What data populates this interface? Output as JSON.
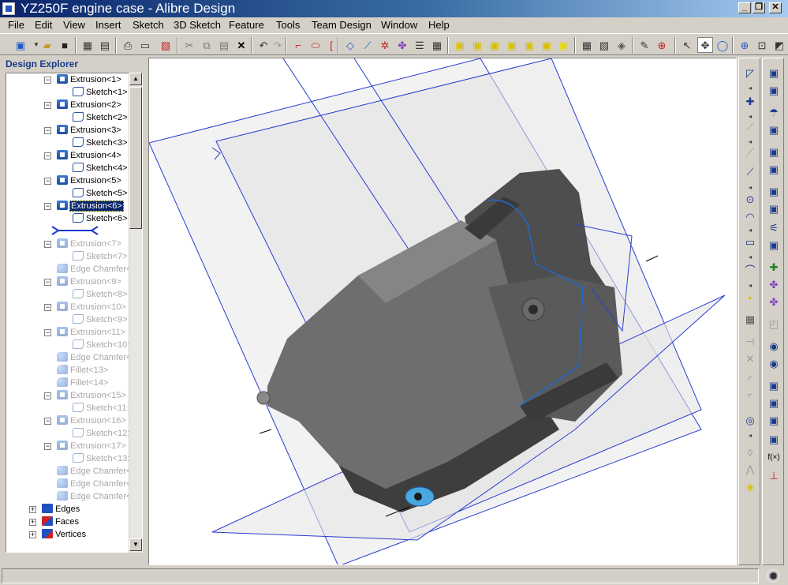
{
  "window": {
    "title": "YZ250F engine case - Alibre Design"
  },
  "menu": [
    "File",
    "Edit",
    "View",
    "Insert",
    "Sketch",
    "3D Sketch",
    "Feature",
    "Tools",
    "Team Design",
    "Window",
    "Help"
  ],
  "explorer": {
    "title": "Design Explorer",
    "nodes": [
      {
        "label": "Extrusion<1>",
        "icon": "extrusion-icon",
        "state": "active"
      },
      {
        "label": "Sketch<1>",
        "icon": "sketch-icon",
        "state": "active"
      },
      {
        "label": "Extrusion<2>",
        "icon": "extrusion-icon",
        "state": "active"
      },
      {
        "label": "Sketch<2>",
        "icon": "sketch-icon",
        "state": "active"
      },
      {
        "label": "Extrusion<3>",
        "icon": "extrusion-icon",
        "state": "active"
      },
      {
        "label": "Sketch<3>",
        "icon": "sketch-icon",
        "state": "active"
      },
      {
        "label": "Extrusion<4>",
        "icon": "extrusion-icon",
        "state": "active"
      },
      {
        "label": "Sketch<4>",
        "icon": "sketch-icon",
        "state": "active"
      },
      {
        "label": "Extrusion<5>",
        "icon": "extrusion-icon",
        "state": "active"
      },
      {
        "label": "Sketch<5>",
        "icon": "sketch-icon",
        "state": "active"
      },
      {
        "label": "Extrusion<6>",
        "icon": "extrusion-icon",
        "state": "selected"
      },
      {
        "label": "Sketch<6>",
        "icon": "sketch-icon",
        "state": "active"
      },
      {
        "label": "",
        "icon": "rollback-marker-icon",
        "state": "marker"
      },
      {
        "label": "Extrusion<7>",
        "icon": "extrusion-icon",
        "state": "suppressed"
      },
      {
        "label": "Sketch<7>",
        "icon": "sketch-icon",
        "state": "suppressed"
      },
      {
        "label": "Edge Chamfer<",
        "icon": "chamfer-icon",
        "state": "suppressed"
      },
      {
        "label": "Extrusion<9>",
        "icon": "extrusion-icon",
        "state": "suppressed"
      },
      {
        "label": "Sketch<8>",
        "icon": "sketch-icon",
        "state": "suppressed"
      },
      {
        "label": "Extrusion<10>",
        "icon": "extrusion-icon",
        "state": "suppressed"
      },
      {
        "label": "Sketch<9>",
        "icon": "sketch-icon",
        "state": "suppressed"
      },
      {
        "label": "Extrusion<11>",
        "icon": "extrusion-icon",
        "state": "suppressed"
      },
      {
        "label": "Sketch<10:",
        "icon": "sketch-icon",
        "state": "suppressed"
      },
      {
        "label": "Edge Chamfer<",
        "icon": "chamfer-icon",
        "state": "suppressed"
      },
      {
        "label": "Fillet<13>",
        "icon": "fillet-icon",
        "state": "suppressed"
      },
      {
        "label": "Fillet<14>",
        "icon": "fillet-icon",
        "state": "suppressed"
      },
      {
        "label": "Extrusion<15>",
        "icon": "extrusion-icon",
        "state": "suppressed"
      },
      {
        "label": "Sketch<11:",
        "icon": "sketch-icon",
        "state": "suppressed"
      },
      {
        "label": "Extrusion<16>",
        "icon": "extrusion-icon",
        "state": "suppressed"
      },
      {
        "label": "Sketch<12:",
        "icon": "sketch-icon",
        "state": "suppressed"
      },
      {
        "label": "Extrusion<17>",
        "icon": "extrusion-icon",
        "state": "suppressed"
      },
      {
        "label": "Sketch<13:",
        "icon": "sketch-icon",
        "state": "suppressed"
      },
      {
        "label": "Edge Chamfer<",
        "icon": "chamfer-icon",
        "state": "suppressed"
      },
      {
        "label": "Edge Chamfer<",
        "icon": "chamfer-icon",
        "state": "suppressed"
      },
      {
        "label": "Edge Chamfer<",
        "icon": "chamfer-icon",
        "state": "suppressed"
      }
    ],
    "groups": [
      {
        "label": "Edges",
        "icon": "edges-icon"
      },
      {
        "label": "Faces",
        "icon": "faces-icon"
      },
      {
        "label": "Vertices",
        "icon": "vertices-icon"
      }
    ]
  },
  "toolbar_icons": [
    "new-part-icon",
    "open-icon",
    "save-icon",
    "save-all-icon",
    "print-icon",
    "print-preview-icon",
    "pdf-icon",
    "cut-icon",
    "copy-icon",
    "paste-icon",
    "delete-icon",
    "undo-icon",
    "redo-icon",
    "sketch-line-icon",
    "sketch-ellipse-icon",
    "sketch-bracket-icon",
    "select-face-icon",
    "select-edge-icon",
    "select-vertex-icon",
    "show-hide-icon",
    "properties-icon",
    "view-front-icon",
    "view-back-icon",
    "view-top-icon",
    "view-bottom-icon",
    "view-left-icon",
    "view-right-icon",
    "wireframe-icon",
    "hidden-lines-icon",
    "shaded-icon",
    "display-options-icon",
    "measure-icon",
    "pointer-icon",
    "pan-icon",
    "zoom-in-icon",
    "zoom-window-icon",
    "rotate-icon"
  ],
  "status": {
    "text": ""
  },
  "colors": {
    "title_bar": "#0a246a",
    "selection": "#0a246a",
    "sketch_plane": "#2a3cd0",
    "model_fill": "#6a6a6a"
  }
}
